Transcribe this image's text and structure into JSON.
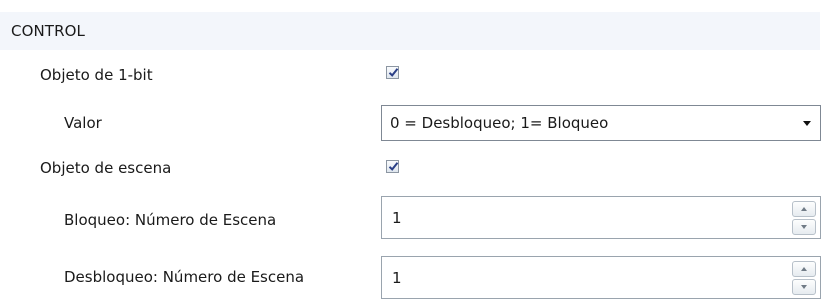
{
  "section": {
    "title": "CONTROL"
  },
  "rows": {
    "object_1bit": {
      "label": "Objeto de 1-bit",
      "checked": true
    },
    "valor": {
      "label": "Valor",
      "selected": "0 = Desbloqueo; 1= Bloqueo"
    },
    "scene_object": {
      "label": "Objeto de escena",
      "checked": true
    },
    "lock_scene": {
      "label": "Bloqueo: Número de Escena",
      "value": "1"
    },
    "unlock_scene": {
      "label": "Desbloqueo: Número de Escena",
      "value": "1"
    }
  },
  "colors": {
    "header_background": "#f3f6fb",
    "check_mark": "#2a3f86",
    "border": "#7f8894"
  },
  "icons": {
    "checkbox": "checkmark-icon",
    "dropdown": "dropdown-arrow-icon",
    "spinner_up": "spinner-up-icon",
    "spinner_down": "spinner-down-icon"
  }
}
